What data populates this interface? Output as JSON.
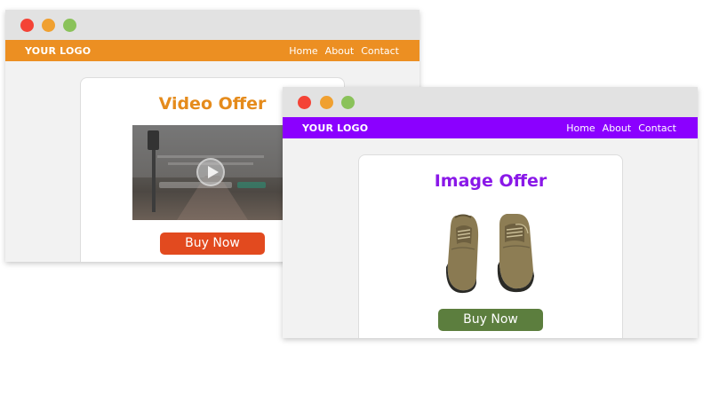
{
  "video_window": {
    "nav": {
      "logo": "YOUR LOGO",
      "links": [
        "Home",
        "About",
        "Contact"
      ]
    },
    "card": {
      "title": "Video Offer",
      "button": "Buy Now"
    },
    "colors": {
      "nav": "#ec8f22",
      "title": "#e58b1c",
      "button": "#e24a1f"
    }
  },
  "image_window": {
    "nav": {
      "logo": "YOUR LOGO",
      "links": [
        "Home",
        "About",
        "Contact"
      ]
    },
    "card": {
      "title": "Image Offer",
      "button": "Buy Now"
    },
    "colors": {
      "nav": "#8b00ff",
      "title": "#8a18e8",
      "button": "#5c7e3e"
    }
  },
  "window_controls": {
    "close": "#f44336",
    "minimize": "#f0a030",
    "maximize": "#8ac25a"
  },
  "icons": [
    "play-icon",
    "shoes-image"
  ]
}
